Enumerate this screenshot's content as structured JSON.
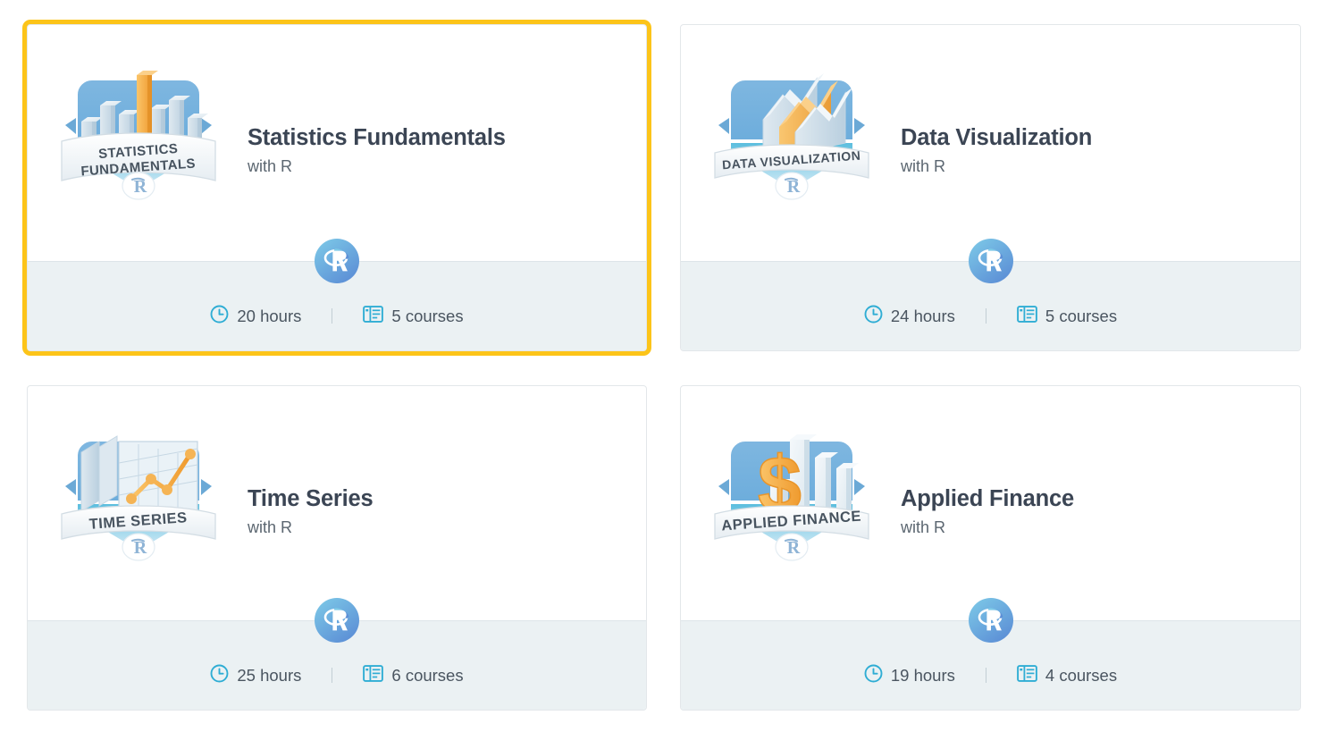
{
  "theme": {
    "selected_outline_color": "#fcc419",
    "card_bg": "#ffffff",
    "card_border": "#e3e7ea",
    "footer_bg": "#ebf1f3",
    "title_color": "#3b4554",
    "subtitle_color": "#5b6670",
    "stat_text_color": "#4a5560",
    "icon_accent": "#2fadd4",
    "badge_blue": "#4fa3d8",
    "badge_orange": "#f5a932"
  },
  "icons": {
    "clock": "clock-icon",
    "courses": "courses-book-icon",
    "technology": "r-language-icon"
  },
  "tracks": [
    {
      "title": "Statistics Fundamentals",
      "subtitle": "with R",
      "badge_label_line1": "STATISTICS",
      "badge_label_line2": "FUNDAMENTALS",
      "badge_art": "bar-chart-skyline",
      "technology": "R",
      "hours": "20 hours",
      "courses": "5 courses",
      "selected": true
    },
    {
      "title": "Data Visualization",
      "subtitle": "with R",
      "badge_label_line1": "DATA VISUALIZATION",
      "badge_label_line2": "",
      "badge_art": "layered-area-chart",
      "technology": "R",
      "hours": "24 hours",
      "courses": "5 courses",
      "selected": false
    },
    {
      "title": "Time Series",
      "subtitle": "with R",
      "badge_label_line1": "TIME SERIES",
      "badge_label_line2": "",
      "badge_art": "line-chart-panels",
      "technology": "R",
      "hours": "25 hours",
      "courses": "6 courses",
      "selected": false
    },
    {
      "title": "Applied Finance",
      "subtitle": "with R",
      "badge_label_line1": "APPLIED FINANCE",
      "badge_label_line2": "",
      "badge_art": "dollar-sign-bars",
      "technology": "R",
      "hours": "19 hours",
      "courses": "4 courses",
      "selected": false
    }
  ]
}
